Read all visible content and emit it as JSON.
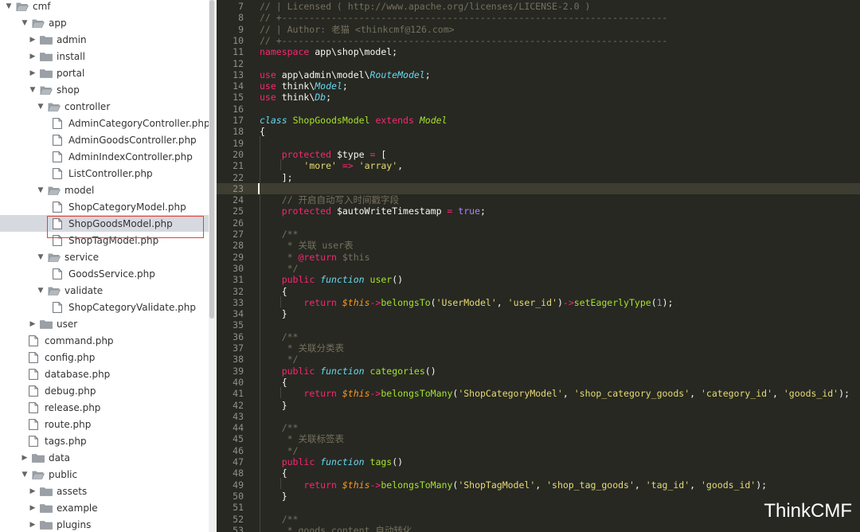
{
  "sidebar": {
    "items": [
      {
        "label": "cmf",
        "kind": "folder",
        "depth": 0,
        "expanded": true
      },
      {
        "label": "app",
        "kind": "folder",
        "depth": 1,
        "expanded": true
      },
      {
        "label": "admin",
        "kind": "folder",
        "depth": 2,
        "expanded": false
      },
      {
        "label": "install",
        "kind": "folder",
        "depth": 2,
        "expanded": false
      },
      {
        "label": "portal",
        "kind": "folder",
        "depth": 2,
        "expanded": false
      },
      {
        "label": "shop",
        "kind": "folder",
        "depth": 2,
        "expanded": true
      },
      {
        "label": "controller",
        "kind": "folder",
        "depth": 3,
        "expanded": true
      },
      {
        "label": "AdminCategoryController.php",
        "kind": "file",
        "depth": 4
      },
      {
        "label": "AdminGoodsController.php",
        "kind": "file",
        "depth": 4
      },
      {
        "label": "AdminIndexController.php",
        "kind": "file",
        "depth": 4
      },
      {
        "label": "ListController.php",
        "kind": "file",
        "depth": 4
      },
      {
        "label": "model",
        "kind": "folder",
        "depth": 3,
        "expanded": true
      },
      {
        "label": "ShopCategoryModel.php",
        "kind": "file",
        "depth": 4
      },
      {
        "label": "ShopGoodsModel.php",
        "kind": "file",
        "depth": 4,
        "selected": true
      },
      {
        "label": "ShopTagModel.php",
        "kind": "file",
        "depth": 4
      },
      {
        "label": "service",
        "kind": "folder",
        "depth": 3,
        "expanded": true
      },
      {
        "label": "GoodsService.php",
        "kind": "file",
        "depth": 4
      },
      {
        "label": "validate",
        "kind": "folder",
        "depth": 3,
        "expanded": true
      },
      {
        "label": "ShopCategoryValidate.php",
        "kind": "file",
        "depth": 4
      },
      {
        "label": "user",
        "kind": "folder",
        "depth": 2,
        "expanded": false
      },
      {
        "label": "command.php",
        "kind": "file",
        "depth": 2
      },
      {
        "label": "config.php",
        "kind": "file",
        "depth": 2
      },
      {
        "label": "database.php",
        "kind": "file",
        "depth": 2
      },
      {
        "label": "debug.php",
        "kind": "file",
        "depth": 2
      },
      {
        "label": "release.php",
        "kind": "file",
        "depth": 2
      },
      {
        "label": "route.php",
        "kind": "file",
        "depth": 2
      },
      {
        "label": "tags.php",
        "kind": "file",
        "depth": 2
      },
      {
        "label": "data",
        "kind": "folder",
        "depth": 1,
        "expanded": false
      },
      {
        "label": "public",
        "kind": "folder",
        "depth": 1,
        "expanded": true
      },
      {
        "label": "assets",
        "kind": "folder",
        "depth": 2,
        "expanded": false
      },
      {
        "label": "example",
        "kind": "folder",
        "depth": 2,
        "expanded": false
      },
      {
        "label": "plugins",
        "kind": "folder",
        "depth": 2,
        "expanded": false
      }
    ]
  },
  "editor": {
    "current_line": 23,
    "lines": [
      {
        "n": "7",
        "t": [
          [
            "c",
            "// | Licensed ( http://www.apache.org/licenses/LICENSE-2.0 )"
          ]
        ]
      },
      {
        "n": "8",
        "t": [
          [
            "c",
            "// +----------------------------------------------------------------------"
          ]
        ]
      },
      {
        "n": "9",
        "t": [
          [
            "c",
            "// | Author: 老猫 <thinkcmf@126.com>"
          ]
        ]
      },
      {
        "n": "10",
        "t": [
          [
            "c",
            "// +----------------------------------------------------------------------"
          ]
        ]
      },
      {
        "n": "11",
        "t": [
          [
            "k",
            "namespace"
          ],
          [
            "p",
            " app\\shop\\model;"
          ]
        ]
      },
      {
        "n": "12",
        "t": []
      },
      {
        "n": "13",
        "t": [
          [
            "k",
            "use"
          ],
          [
            "p",
            " app\\admin\\model\\"
          ],
          [
            "i",
            "RouteModel"
          ],
          [
            "p",
            ";"
          ]
        ]
      },
      {
        "n": "14",
        "t": [
          [
            "k",
            "use"
          ],
          [
            "p",
            " think\\"
          ],
          [
            "i",
            "Model"
          ],
          [
            "p",
            ";"
          ]
        ]
      },
      {
        "n": "15",
        "t": [
          [
            "k",
            "use"
          ],
          [
            "p",
            " think\\"
          ],
          [
            "i",
            "Db"
          ],
          [
            "p",
            ";"
          ]
        ]
      },
      {
        "n": "16",
        "t": []
      },
      {
        "n": "17",
        "t": [
          [
            "i",
            "class"
          ],
          [
            "p",
            " "
          ],
          [
            "f",
            "ShopGoodsModel"
          ],
          [
            "p",
            " "
          ],
          [
            "k",
            "extends"
          ],
          [
            "p",
            " "
          ],
          [
            "g",
            "Model"
          ]
        ]
      },
      {
        "n": "18",
        "t": [
          [
            "p",
            "{"
          ]
        ]
      },
      {
        "n": "19",
        "t": []
      },
      {
        "n": "20",
        "t": [
          [
            "p",
            "    "
          ],
          [
            "k",
            "protected"
          ],
          [
            "p",
            " $type "
          ],
          [
            "k",
            "="
          ],
          [
            "p",
            " ["
          ]
        ]
      },
      {
        "n": "21",
        "t": [
          [
            "p",
            "        "
          ],
          [
            "s",
            "'more'"
          ],
          [
            "p",
            " "
          ],
          [
            "k",
            "=>"
          ],
          [
            "p",
            " "
          ],
          [
            "s",
            "'array'"
          ],
          [
            "p",
            ","
          ]
        ]
      },
      {
        "n": "22",
        "t": [
          [
            "p",
            "    ];"
          ]
        ]
      },
      {
        "n": "23",
        "t": []
      },
      {
        "n": "24",
        "t": [
          [
            "p",
            "    "
          ],
          [
            "c",
            "// 开启自动写入时间戳字段"
          ]
        ]
      },
      {
        "n": "25",
        "t": [
          [
            "p",
            "    "
          ],
          [
            "k",
            "protected"
          ],
          [
            "p",
            " $autoWriteTimestamp "
          ],
          [
            "k",
            "="
          ],
          [
            "p",
            " "
          ],
          [
            "m",
            "true"
          ],
          [
            "p",
            ";"
          ]
        ]
      },
      {
        "n": "26",
        "t": []
      },
      {
        "n": "27",
        "t": [
          [
            "p",
            "    "
          ],
          [
            "c",
            "/**"
          ]
        ]
      },
      {
        "n": "28",
        "t": [
          [
            "p",
            "    "
          ],
          [
            "c",
            " * 关联 user表"
          ]
        ]
      },
      {
        "n": "29",
        "t": [
          [
            "p",
            "    "
          ],
          [
            "c",
            " * "
          ],
          [
            "k",
            "@return"
          ],
          [
            "c",
            " $this"
          ]
        ]
      },
      {
        "n": "30",
        "t": [
          [
            "p",
            "    "
          ],
          [
            "c",
            " */"
          ]
        ]
      },
      {
        "n": "31",
        "t": [
          [
            "p",
            "    "
          ],
          [
            "k",
            "public"
          ],
          [
            "p",
            " "
          ],
          [
            "i",
            "function"
          ],
          [
            "p",
            " "
          ],
          [
            "f",
            "user"
          ],
          [
            "p",
            "()"
          ]
        ]
      },
      {
        "n": "32",
        "t": [
          [
            "p",
            "    {"
          ]
        ]
      },
      {
        "n": "33",
        "t": [
          [
            "p",
            "        "
          ],
          [
            "k",
            "return"
          ],
          [
            "p",
            " "
          ],
          [
            "v",
            "$this"
          ],
          [
            "k",
            "->"
          ],
          [
            "f",
            "belongsTo"
          ],
          [
            "p",
            "("
          ],
          [
            "s",
            "'UserModel'"
          ],
          [
            "p",
            ", "
          ],
          [
            "s",
            "'user_id'"
          ],
          [
            "p",
            ")"
          ],
          [
            "k",
            "->"
          ],
          [
            "f",
            "setEagerlyType"
          ],
          [
            "p",
            "("
          ],
          [
            "m",
            "1"
          ],
          [
            "p",
            ");"
          ]
        ]
      },
      {
        "n": "34",
        "t": [
          [
            "p",
            "    }"
          ]
        ]
      },
      {
        "n": "35",
        "t": []
      },
      {
        "n": "36",
        "t": [
          [
            "p",
            "    "
          ],
          [
            "c",
            "/**"
          ]
        ]
      },
      {
        "n": "37",
        "t": [
          [
            "p",
            "    "
          ],
          [
            "c",
            " * 关联分类表"
          ]
        ]
      },
      {
        "n": "38",
        "t": [
          [
            "p",
            "    "
          ],
          [
            "c",
            " */"
          ]
        ]
      },
      {
        "n": "39",
        "t": [
          [
            "p",
            "    "
          ],
          [
            "k",
            "public"
          ],
          [
            "p",
            " "
          ],
          [
            "i",
            "function"
          ],
          [
            "p",
            " "
          ],
          [
            "f",
            "categories"
          ],
          [
            "p",
            "()"
          ]
        ]
      },
      {
        "n": "40",
        "t": [
          [
            "p",
            "    {"
          ]
        ]
      },
      {
        "n": "41",
        "t": [
          [
            "p",
            "        "
          ],
          [
            "k",
            "return"
          ],
          [
            "p",
            " "
          ],
          [
            "v",
            "$this"
          ],
          [
            "k",
            "->"
          ],
          [
            "f",
            "belongsToMany"
          ],
          [
            "p",
            "("
          ],
          [
            "s",
            "'ShopCategoryModel'"
          ],
          [
            "p",
            ", "
          ],
          [
            "s",
            "'shop_category_goods'"
          ],
          [
            "p",
            ", "
          ],
          [
            "s",
            "'category_id'"
          ],
          [
            "p",
            ", "
          ],
          [
            "s",
            "'goods_id'"
          ],
          [
            "p",
            ");"
          ]
        ]
      },
      {
        "n": "42",
        "t": [
          [
            "p",
            "    }"
          ]
        ]
      },
      {
        "n": "43",
        "t": []
      },
      {
        "n": "44",
        "t": [
          [
            "p",
            "    "
          ],
          [
            "c",
            "/**"
          ]
        ]
      },
      {
        "n": "45",
        "t": [
          [
            "p",
            "    "
          ],
          [
            "c",
            " * 关联标签表"
          ]
        ]
      },
      {
        "n": "46",
        "t": [
          [
            "p",
            "    "
          ],
          [
            "c",
            " */"
          ]
        ]
      },
      {
        "n": "47",
        "t": [
          [
            "p",
            "    "
          ],
          [
            "k",
            "public"
          ],
          [
            "p",
            " "
          ],
          [
            "i",
            "function"
          ],
          [
            "p",
            " "
          ],
          [
            "f",
            "tags"
          ],
          [
            "p",
            "()"
          ]
        ]
      },
      {
        "n": "48",
        "t": [
          [
            "p",
            "    {"
          ]
        ]
      },
      {
        "n": "49",
        "t": [
          [
            "p",
            "        "
          ],
          [
            "k",
            "return"
          ],
          [
            "p",
            " "
          ],
          [
            "v",
            "$this"
          ],
          [
            "k",
            "->"
          ],
          [
            "f",
            "belongsToMany"
          ],
          [
            "p",
            "("
          ],
          [
            "s",
            "'ShopTagModel'"
          ],
          [
            "p",
            ", "
          ],
          [
            "s",
            "'shop_tag_goods'"
          ],
          [
            "p",
            ", "
          ],
          [
            "s",
            "'tag_id'"
          ],
          [
            "p",
            ", "
          ],
          [
            "s",
            "'goods_id'"
          ],
          [
            "p",
            ");"
          ]
        ]
      },
      {
        "n": "50",
        "t": [
          [
            "p",
            "    }"
          ]
        ]
      },
      {
        "n": "51",
        "t": []
      },
      {
        "n": "52",
        "t": [
          [
            "p",
            "    "
          ],
          [
            "c",
            "/**"
          ]
        ]
      },
      {
        "n": "53",
        "t": [
          [
            "p",
            "    "
          ],
          [
            "c",
            " * goods_content 自动转化"
          ]
        ]
      }
    ]
  },
  "watermark": "ThinkCMF",
  "colors": {
    "editor_bg": "#272822",
    "sidebar_selected": "#d6d9e0",
    "highlight_border": "#e0423a",
    "comment": "#75715e",
    "keyword": "#f92672",
    "string": "#e6db74",
    "function": "#a6e22e",
    "number": "#ae81ff"
  }
}
